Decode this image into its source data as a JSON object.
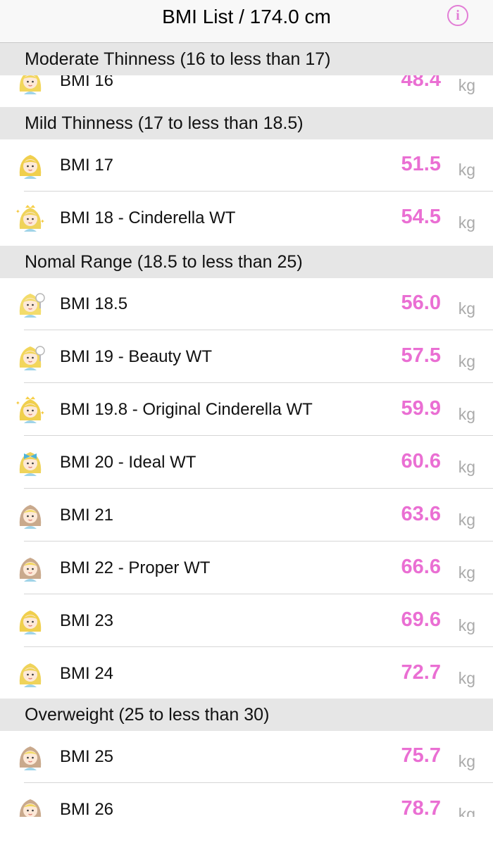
{
  "navbar": {
    "title": "BMI List / 174.0 cm",
    "info_icon": "info-circle-icon",
    "info_glyph": "i"
  },
  "colors": {
    "accent": "#ea6fd3",
    "header_bg": "#e6e6e6",
    "unit": "#aaaaaa"
  },
  "unit": "kg",
  "sections": [
    {
      "title": "Moderate Thinness (16 to less than 17)",
      "rows": [
        {
          "label": "BMI 16",
          "value": "48.4",
          "avatar": "girl-avatar-icon"
        }
      ]
    },
    {
      "title": "Mild Thinness (17 to less than 18.5)",
      "rows": [
        {
          "label": "BMI 17",
          "value": "51.5",
          "avatar": "girl-avatar-icon"
        },
        {
          "label": "BMI 18 - Cinderella WT",
          "value": "54.5",
          "avatar": "princess-sparkle-icon"
        }
      ]
    },
    {
      "title": "Nomal Range (18.5 to less than 25)",
      "rows": [
        {
          "label": "BMI 18.5",
          "value": "56.0",
          "avatar": "girl-mirror-icon"
        },
        {
          "label": "BMI 19 - Beauty WT",
          "value": "57.5",
          "avatar": "girl-mirror-icon"
        },
        {
          "label": "BMI 19.8 - Original Cinderella WT",
          "value": "59.9",
          "avatar": "princess-sparkle-icon"
        },
        {
          "label": "BMI 20 - Ideal WT",
          "value": "60.6",
          "avatar": "girl-bow-icon"
        },
        {
          "label": "BMI 21",
          "value": "63.6",
          "avatar": "girl-hood-icon"
        },
        {
          "label": "BMI 22 - Proper WT",
          "value": "66.6",
          "avatar": "girl-hood-icon"
        },
        {
          "label": "BMI 23",
          "value": "69.6",
          "avatar": "girl-avatar-icon"
        },
        {
          "label": "BMI 24",
          "value": "72.7",
          "avatar": "girl-avatar-icon"
        }
      ]
    },
    {
      "title": "Overweight (25 to less than 30)",
      "rows": [
        {
          "label": "BMI 25",
          "value": "75.7",
          "avatar": "girl-hood-icon"
        },
        {
          "label": "BMI 26",
          "value": "78.7",
          "avatar": "girl-hood-icon"
        }
      ]
    }
  ]
}
